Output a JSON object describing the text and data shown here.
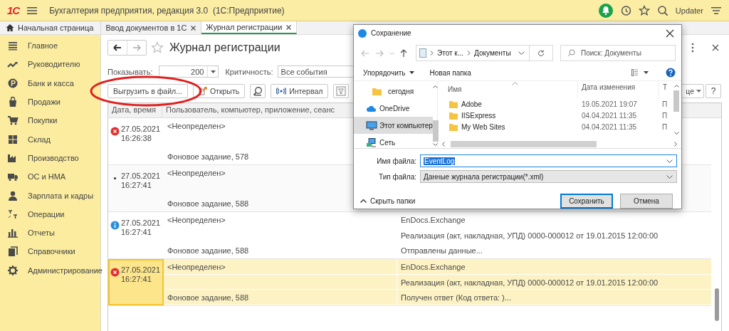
{
  "app_bar": {
    "logo": "1С",
    "title": "Бухгалтерия предприятия, редакция 3.0  (1С:Предприятие)",
    "user": "Updater"
  },
  "tabs": [
    {
      "label": "Начальная страница",
      "kind": "home",
      "selected": false
    },
    {
      "label": "Ввод документов в 1С",
      "kind": "closable",
      "selected": false
    },
    {
      "label": "Журнал регистрации",
      "kind": "closable",
      "selected": true
    }
  ],
  "sidebar": {
    "items": [
      {
        "label": "Главное"
      },
      {
        "label": "Руководителю"
      },
      {
        "label": "Банк и касса"
      },
      {
        "label": "Продажи"
      },
      {
        "label": "Покупки"
      },
      {
        "label": "Склад"
      },
      {
        "label": "Производство"
      },
      {
        "label": "ОС и НМА"
      },
      {
        "label": "Зарплата и кадры"
      },
      {
        "label": "Операции"
      },
      {
        "label": "Отчеты"
      },
      {
        "label": "Справочники"
      },
      {
        "label": "Администрирование"
      }
    ]
  },
  "form": {
    "title": "Журнал регистрации",
    "filters": [
      {
        "label": "Показывать:",
        "value": "200",
        "kind": "number"
      },
      {
        "label": "Критичность:",
        "value": "Все события",
        "kind": "text"
      }
    ],
    "toolbar": [
      {
        "label": "Выгрузить в файл...",
        "kind": "text"
      },
      {
        "label": "Открыть",
        "kind": "open"
      },
      {
        "kind": "search"
      },
      {
        "label": "Интервал",
        "kind": "interval"
      },
      {
        "kind": "filter"
      }
    ],
    "toolbar_right": [
      {
        "label": "це",
        "kind": "menu"
      },
      {
        "label": "?",
        "kind": "text"
      }
    ],
    "table": {
      "columns": [
        "Дата, время",
        "Пользователь, компьютер, приложение, сеанс"
      ],
      "rows": [
        {
          "kind": "error",
          "date": "27.05.2021",
          "time": "16:26:38",
          "user": "<Неопределен>",
          "session": "Фоновое задание, 578",
          "selected": false
        },
        {
          "kind": "note",
          "date": "27.05.2021",
          "time": "16:27:41",
          "user": "<Неопределен>",
          "session": "Фоновое задание, 588",
          "selected": false
        },
        {
          "kind": "info",
          "date": "27.05.2021",
          "time": "16:27:41",
          "user": "<Неопределен>",
          "session": "Фоновое задание, 588",
          "event": [
            "EnDocs.Exchange",
            "Реализация (акт, накладная, УПД) 0000-000012 от 19.01.2015 12:00:00",
            "Отправлены данные..."
          ],
          "selected": false
        },
        {
          "kind": "error",
          "date": "27.05.2021",
          "time": "16:27:41",
          "user": "<Неопределен>",
          "session": "Фоновое задание, 588",
          "event": [
            "EnDocs.Exchange",
            "Реализация (акт, накладная, УПД) 0000-000012 от 19.01.2015 12:00:00",
            "Получен ответ (Код ответа: )..."
          ],
          "selected": true
        }
      ]
    }
  },
  "dialog": {
    "title": "Сохранение",
    "path": [
      "Этот к...",
      "Документы"
    ],
    "search_placeholder": "Поиск: Документы",
    "commands": [
      {
        "label": "Упорядочить",
        "kind": "menu"
      },
      {
        "label": "Новая папка",
        "kind": "plain"
      }
    ],
    "nav": [
      {
        "label": "сегодня",
        "kind": "folder",
        "selected": false
      },
      {
        "label": "OneDrive",
        "kind": "cloud",
        "selected": false
      },
      {
        "label": "Этот компьютер",
        "kind": "computer",
        "selected": true
      },
      {
        "label": "Сеть",
        "kind": "network",
        "selected": false
      }
    ],
    "columns": [
      "Имя",
      "Дата изменения",
      "Т"
    ],
    "files": [
      {
        "name": "Adobe",
        "date": "19.05.2021 19:07",
        "type": "П"
      },
      {
        "name": "IISExpress",
        "date": "04.04.2021 11:35",
        "type": "П"
      },
      {
        "name": "My Web Sites",
        "date": "04.04.2021 11:35",
        "type": "П"
      }
    ],
    "fields": [
      {
        "label": "Имя файла:",
        "value": "EventLog",
        "kind": "input"
      },
      {
        "label": "Тип файла:",
        "value": "Данные журнала регистрации(*.xml)",
        "kind": "select"
      }
    ],
    "hide_folders": "Скрыть папки",
    "buttons": [
      {
        "label": "Сохранить",
        "default": true
      },
      {
        "label": "Отмена",
        "default": false
      }
    ]
  }
}
